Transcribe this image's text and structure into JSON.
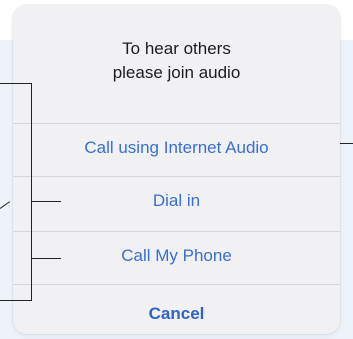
{
  "dialog": {
    "title_line1": "To hear others",
    "title_line2": "please join audio"
  },
  "actions": [
    {
      "label": "Call using Internet Audio"
    },
    {
      "label": "Dial in"
    },
    {
      "label": "Call My Phone"
    },
    {
      "label": "Cancel"
    }
  ],
  "colors": {
    "action_text": "#3a6fd1",
    "sheet_bg": "#f1f1f3",
    "backdrop": "#eef3fa"
  }
}
